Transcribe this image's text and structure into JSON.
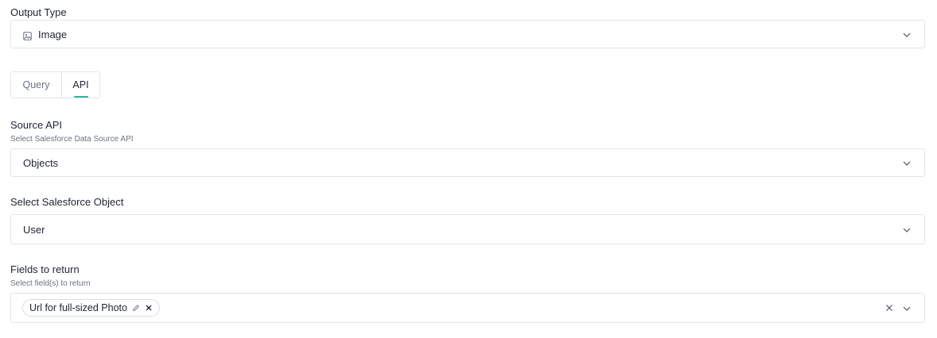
{
  "output_type": {
    "label": "Output Type",
    "value": "Image",
    "icon": "image-icon"
  },
  "tabs": [
    {
      "label": "Query",
      "active": false
    },
    {
      "label": "API",
      "active": true
    }
  ],
  "accent_color": "#2bb59a",
  "source_api": {
    "label": "Source API",
    "helper": "Select Salesforce Data Source API",
    "value": "Objects"
  },
  "salesforce_object": {
    "label": "Select Salesforce Object",
    "value": "User"
  },
  "fields": {
    "label": "Fields to return",
    "helper": "Select field(s) to return",
    "selected": [
      "Url for full-sized Photo"
    ]
  }
}
